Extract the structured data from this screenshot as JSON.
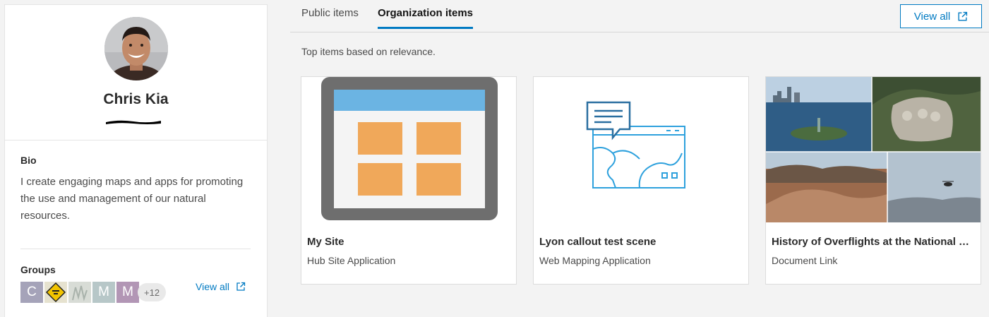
{
  "profile": {
    "name": "Chris Kia",
    "bio_title": "Bio",
    "bio_text": "I create engaging maps and apps for promoting the use and management of our natural resources.",
    "groups_title": "Groups",
    "groups": [
      {
        "letter": "C",
        "color": "#a5a3b9"
      },
      {
        "letter": "",
        "icon": "road-sign-icon"
      },
      {
        "letter": "",
        "icon": "sketch-thumbnail"
      },
      {
        "letter": "M",
        "color": "#b7c7c8"
      },
      {
        "letter": "M",
        "color": "#b296b5"
      }
    ],
    "groups_more": "+12",
    "groups_view_all": "View all"
  },
  "tabs": [
    {
      "label": "Public items",
      "active": false
    },
    {
      "label": "Organization items",
      "active": true
    }
  ],
  "view_all_label": "View all",
  "subtitle": "Top items based on relevance.",
  "items": [
    {
      "title": "My Site",
      "type": "Hub Site Application",
      "thumbnail": "hub-site-thumbnail"
    },
    {
      "title": "Lyon callout test scene",
      "type": "Web Mapping Application",
      "thumbnail": "web-map-app-thumbnail"
    },
    {
      "title": "History of Overflights at the National Parks",
      "type": "Document Link",
      "thumbnail": "photo-collage-thumbnail"
    }
  ],
  "colors": {
    "accent": "#007ac2",
    "hub_header": "#6bb4e3",
    "hub_block": "#f0a85a",
    "hub_frame": "#6e6e6e"
  }
}
